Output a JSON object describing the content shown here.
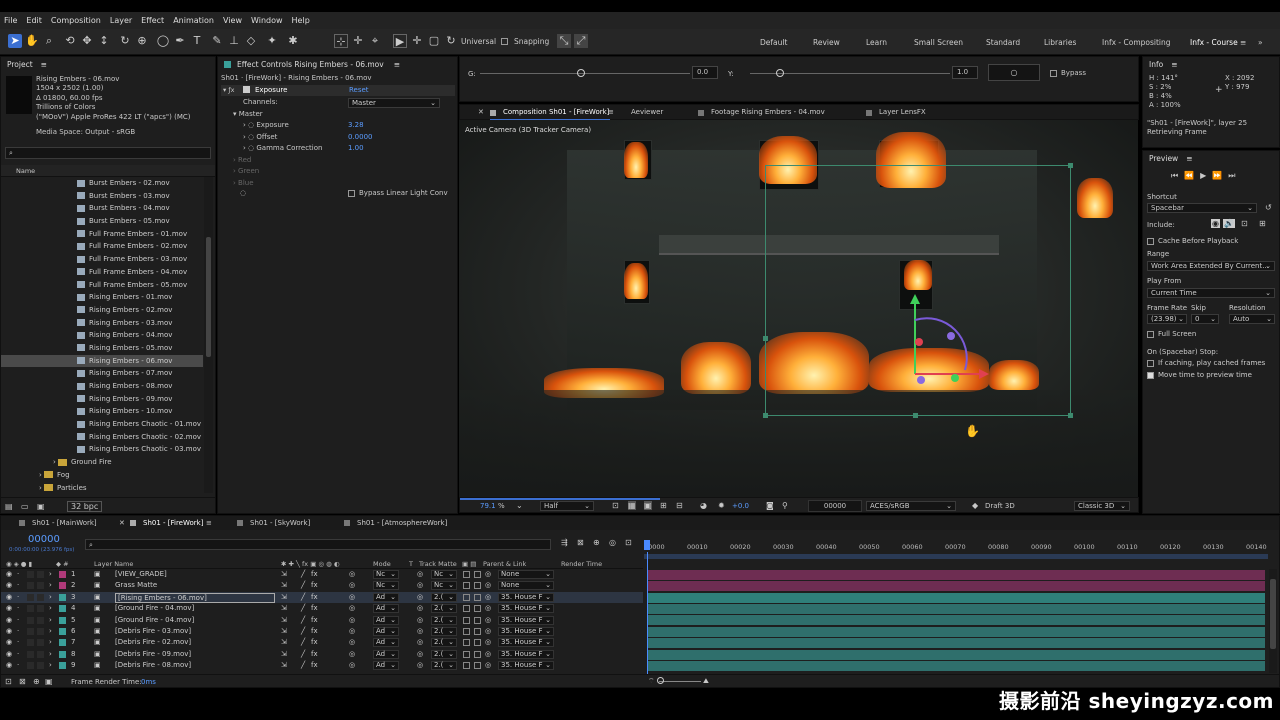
{
  "menu": [
    "File",
    "Edit",
    "Composition",
    "Layer",
    "Effect",
    "Animation",
    "View",
    "Window",
    "Help"
  ],
  "toolbar": {
    "universal": "Universal",
    "snapping": "Snapping",
    "workspaces": [
      "Default",
      "Review",
      "Learn",
      "Small Screen",
      "Standard",
      "Libraries",
      "Infx - Compositing",
      "Infx - Course"
    ]
  },
  "project": {
    "title": "Project",
    "item_name": "Rising Embers - 06.mov",
    "meta": [
      "1504 x 2502 (1.00)",
      "Δ 01800, 60.00 fps",
      "Trillions of Colors",
      "(\"MOoV\") Apple ProRes 422 LT (\"apcs\") (MC)"
    ],
    "media_space": "Media Space: Output - sRGB",
    "search_placeholder": "",
    "column_name": "Name",
    "files": [
      "Burst Embers - 02.mov",
      "Burst Embers - 03.mov",
      "Burst Embers - 04.mov",
      "Burst Embers - 05.mov",
      "Full Frame Embers - 01.mov",
      "Full Frame Embers - 02.mov",
      "Full Frame Embers - 03.mov",
      "Full Frame Embers - 04.mov",
      "Full Frame Embers - 05.mov",
      "Rising Embers - 01.mov",
      "Rising Embers - 02.mov",
      "Rising Embers - 03.mov",
      "Rising Embers - 04.mov",
      "Rising Embers - 05.mov",
      "Rising Embers - 06.mov",
      "Rising Embers - 07.mov",
      "Rising Embers - 08.mov",
      "Rising Embers - 09.mov",
      "Rising Embers - 10.mov",
      "Rising Embers Chaotic - 01.mov",
      "Rising Embers Chaotic - 02.mov",
      "Rising Embers Chaotic - 03.mov"
    ],
    "folders": [
      "Ground Fire",
      "Fog",
      "Particles"
    ],
    "bpc": "32 bpc"
  },
  "effects": {
    "tab": "Effect Controls Rising Embers - 06.mov",
    "path": "Sh01 · [FireWork] - Rising Embers - 06.mov",
    "effect_name": "Exposure",
    "reset": "Reset",
    "channels_label": "Channels:",
    "channels_value": "Master",
    "master": "Master",
    "params": [
      {
        "label": "Exposure",
        "value": "3.28"
      },
      {
        "label": "Offset",
        "value": "0.0000"
      },
      {
        "label": "Gamma Correction",
        "value": "1.00"
      }
    ],
    "disabled": [
      "Red",
      "Green",
      "Blue"
    ],
    "bypass": "Bypass Linear Light Conv"
  },
  "controls": {
    "g_label": "G:",
    "g_value": "0.0",
    "y_label": "Y:",
    "y_value": "1.0",
    "bypass": "Bypass"
  },
  "comp": {
    "tabs": [
      "Composition Sh01 - [FireWork]",
      "Aeviewer",
      "Footage Rising Embers - 04.mov",
      "Layer LensFX"
    ],
    "camera": "Active Camera (3D Tracker Camera)",
    "zoom": "79.1",
    "zoom_unit": "%",
    "resolution": "Half",
    "exposure": "+0.0",
    "timecode": "00000",
    "color": "ACES/sRGB",
    "draft": "Draft 3D",
    "renderer": "Classic 3D"
  },
  "info": {
    "title": "Info",
    "h": "H : 141°",
    "s": "S : 2%",
    "b": "B : 4%",
    "a": "A : 100%",
    "x": "X : 2092",
    "y": "Y : 979",
    "layer": "\"Sh01 - [FireWork]\", layer 25",
    "status": "Retrieving Frame"
  },
  "preview": {
    "title": "Preview",
    "shortcut_label": "Shortcut",
    "shortcut": "Spacebar",
    "include": "Include:",
    "cache": "Cache Before Playback",
    "range_label": "Range",
    "range": "Work Area Extended By Current...",
    "play_from_label": "Play From",
    "play_from": "Current Time",
    "frame_rate_label": "Frame Rate",
    "skip_label": "Skip",
    "res_label": "Resolution",
    "frame_rate": "(23.98)",
    "skip": "0",
    "res": "Auto",
    "full_screen": "Full Screen",
    "stop_label": "On (Spacebar) Stop:",
    "if_caching": "If caching, play cached frames",
    "move_time": "Move time to preview time"
  },
  "timeline": {
    "tabs": [
      "Sh01 - [MainWork]",
      "Sh01 - [FireWork]",
      "Sh01 - [SkyWork]",
      "Sh01 - [AtmosphereWork]"
    ],
    "timecode": "00000",
    "sub_timecode": "0:00:00:00 (23.976 fps)",
    "col_layer": "Layer Name",
    "col_mode": "Mode",
    "col_t": "T",
    "col_track": "Track Matte",
    "col_parent": "Parent & Link",
    "col_render": "Render Time",
    "ruler": [
      "00000",
      "00010",
      "00020",
      "00030",
      "00040",
      "00050",
      "00060",
      "00070",
      "00080",
      "00090",
      "00100",
      "00110",
      "00120",
      "00130",
      "00140"
    ],
    "layers": [
      {
        "n": "1",
        "name": "[VIEW_GRADE]",
        "mode": "Nc",
        "tm": "Nc",
        "parent": "None",
        "color": "#b03a7a",
        "bar": "#6e2d52"
      },
      {
        "n": "2",
        "name": "Grass Matte",
        "mode": "Nc",
        "tm": "Nc",
        "parent": "None",
        "color": "#b03a7a",
        "bar": "#6e2d52"
      },
      {
        "n": "3",
        "name": "[Rising Embers - 06.mov]",
        "mode": "Ad",
        "tm": "2.(",
        "parent": "35. House F",
        "color": "#3aa09a",
        "bar": "#2f7f7a"
      },
      {
        "n": "4",
        "name": "[Ground Fire - 04.mov]",
        "mode": "Ad",
        "tm": "2.(",
        "parent": "35. House F",
        "color": "#3aa09a",
        "bar": "#2f6f6c"
      },
      {
        "n": "5",
        "name": "[Ground Fire - 04.mov]",
        "mode": "Ad",
        "tm": "2.(",
        "parent": "35. House F",
        "color": "#3aa09a",
        "bar": "#2f6f6c"
      },
      {
        "n": "6",
        "name": "[Debris Fire - 03.mov]",
        "mode": "Ad",
        "tm": "2.(",
        "parent": "35. House F",
        "color": "#3aa09a",
        "bar": "#2f6f6c"
      },
      {
        "n": "7",
        "name": "[Debris Fire - 02.mov]",
        "mode": "Ad",
        "tm": "2.(",
        "parent": "35. House F",
        "color": "#3aa09a",
        "bar": "#2f6f6c"
      },
      {
        "n": "8",
        "name": "[Debris Fire - 09.mov]",
        "mode": "Ad",
        "tm": "2.(",
        "parent": "35. House F",
        "color": "#3aa09a",
        "bar": "#2f6f6c"
      },
      {
        "n": "9",
        "name": "[Debris Fire - 08.mov]",
        "mode": "Ad",
        "tm": "2.(",
        "parent": "35. House F",
        "color": "#3aa09a",
        "bar": "#2f6f6c"
      }
    ],
    "frame_render_label": "Frame Render Time:",
    "frame_render_value": "0ms"
  },
  "watermark": "摄影前沿 sheyingzyz.com"
}
